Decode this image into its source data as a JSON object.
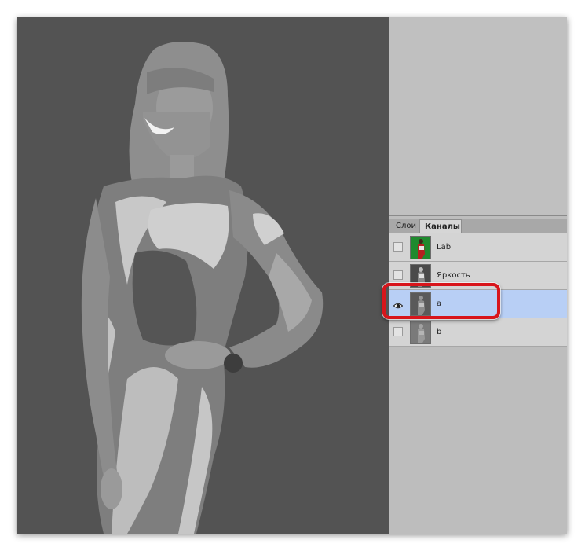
{
  "channels_panel": {
    "tabs": [
      {
        "label": "Слои",
        "active": false
      },
      {
        "label": "Каналы",
        "active": true
      }
    ],
    "channels": [
      {
        "label": "Lab",
        "visible": false,
        "selected": false,
        "thumbnail": "color-portrait"
      },
      {
        "label": "Яркость",
        "visible": false,
        "selected": false,
        "thumbnail": "grayscale-portrait"
      },
      {
        "label": "a",
        "visible": true,
        "selected": true,
        "thumbnail": "grayscale-portrait"
      },
      {
        "label": "b",
        "visible": false,
        "selected": false,
        "thumbnail": "grayscale-portrait"
      }
    ]
  },
  "annotation": {
    "color": "#d8151b",
    "target": "a"
  },
  "colors": {
    "canvas_bg": "#535353",
    "selected_row": "#b8cff5",
    "panel_bg": "#d4d4d4"
  },
  "icons": {
    "visibility": "eye-icon"
  }
}
